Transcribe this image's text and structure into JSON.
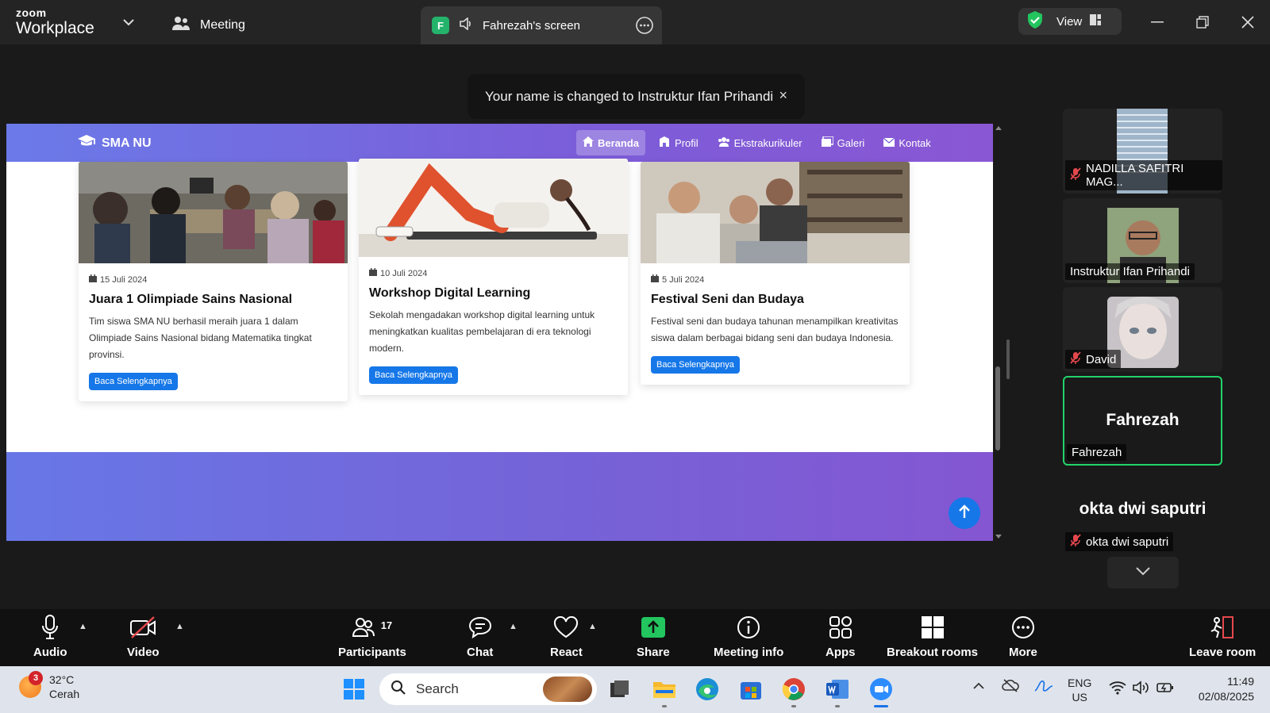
{
  "app": {
    "brand_top": "zoom",
    "brand_bottom": "Workplace",
    "meeting_label": "Meeting"
  },
  "share_tab": {
    "badge": "F",
    "title": "Fahrezah's screen"
  },
  "view": {
    "label": "View"
  },
  "toast": {
    "message": "Your name is changed to Instruktur Ifan Prihandi",
    "close": "×"
  },
  "website": {
    "logo": "SMA NU",
    "menu": [
      {
        "label": "Beranda",
        "icon": "home-icon",
        "active": true
      },
      {
        "label": "Profil",
        "icon": "school-icon"
      },
      {
        "label": "Ekstrakurikuler",
        "icon": "users-icon"
      },
      {
        "label": "Galeri",
        "icon": "images-icon"
      },
      {
        "label": "Kontak",
        "icon": "envelope-icon"
      }
    ],
    "cards": [
      {
        "date": "15 Juli 2024",
        "title": "Juara 1 Olimpiade Sains Nasional",
        "text": "Tim siswa SMA NU berhasil meraih juara 1 dalam Olimpiade Sains Nasional bidang Matematika tingkat provinsi.",
        "button": "Baca Selengkapnya"
      },
      {
        "date": "10 Juli 2024",
        "title": "Workshop Digital Learning",
        "text": "Sekolah mengadakan workshop digital learning untuk meningkatkan kualitas pembelajaran di era teknologi modern.",
        "button": "Baca Selengkapnya"
      },
      {
        "date": "5 Juli 2024",
        "title": "Festival Seni dan Budaya",
        "text": "Festival seni dan budaya tahunan menampilkan kreativitas siswa dalam berbagai bidang seni dan budaya Indonesia.",
        "button": "Baca Selengkapnya"
      }
    ]
  },
  "gallery": [
    {
      "name": "NADILLA SAFITRI MAG...",
      "muted": true
    },
    {
      "name": "Instruktur Ifan Prihandi",
      "muted": false
    },
    {
      "name": "David",
      "muted": true
    },
    {
      "name": "Fahrezah",
      "display": "Fahrezah",
      "muted": false,
      "active": true
    },
    {
      "name": "okta dwi saputri",
      "display": "okta dwi saputri",
      "muted": true
    }
  ],
  "toolbar": {
    "audio": "Audio",
    "video": "Video",
    "participants": "Participants",
    "participants_count": "17",
    "chat": "Chat",
    "react": "React",
    "share": "Share",
    "meeting_info": "Meeting info",
    "apps": "Apps",
    "breakout": "Breakout rooms",
    "more": "More",
    "leave": "Leave room"
  },
  "taskbar": {
    "weather_badge": "3",
    "temp": "32°C",
    "condition": "Cerah",
    "search": "Search",
    "lang_top": "ENG",
    "lang_bottom": "US",
    "time": "11:49",
    "date": "02/08/2025"
  },
  "colors": {
    "accent_green": "#22d36b",
    "share_green": "#24b36b",
    "site_blue": "#1677e8",
    "site_gradient_start": "#6b7ae8",
    "site_gradient_end": "#8a57d4"
  }
}
